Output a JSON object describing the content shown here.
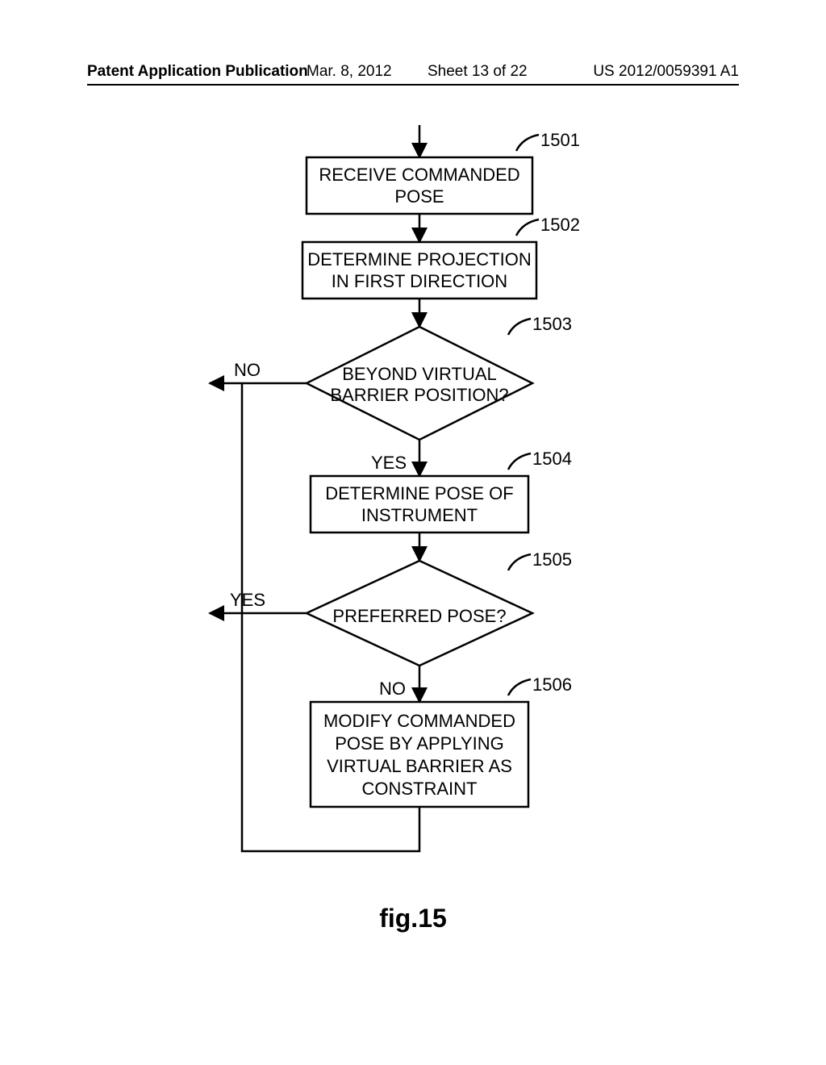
{
  "header": {
    "left": "Patent Application Publication",
    "date": "Mar. 8, 2012",
    "sheet": "Sheet 13 of 22",
    "pubno": "US 2012/0059391 A1"
  },
  "figure_label": "fig.15",
  "steps": {
    "s1501": {
      "ref": "1501",
      "line1": "RECEIVE COMMANDED",
      "line2": "POSE"
    },
    "s1502": {
      "ref": "1502",
      "line1": "DETERMINE PROJECTION",
      "line2": "IN FIRST DIRECTION"
    },
    "s1503": {
      "ref": "1503",
      "line1": "BEYOND VIRTUAL",
      "line2": "BARRIER POSITION?"
    },
    "s1504": {
      "ref": "1504",
      "line1": "DETERMINE POSE OF",
      "line2": "INSTRUMENT"
    },
    "s1505": {
      "ref": "1505",
      "text": "PREFERRED POSE?"
    },
    "s1506": {
      "ref": "1506",
      "line1": "MODIFY COMMANDED",
      "line2": "POSE BY APPLYING",
      "line3": "VIRTUAL BARRIER AS",
      "line4": "CONSTRAINT"
    }
  },
  "labels": {
    "yes": "YES",
    "no": "NO"
  }
}
